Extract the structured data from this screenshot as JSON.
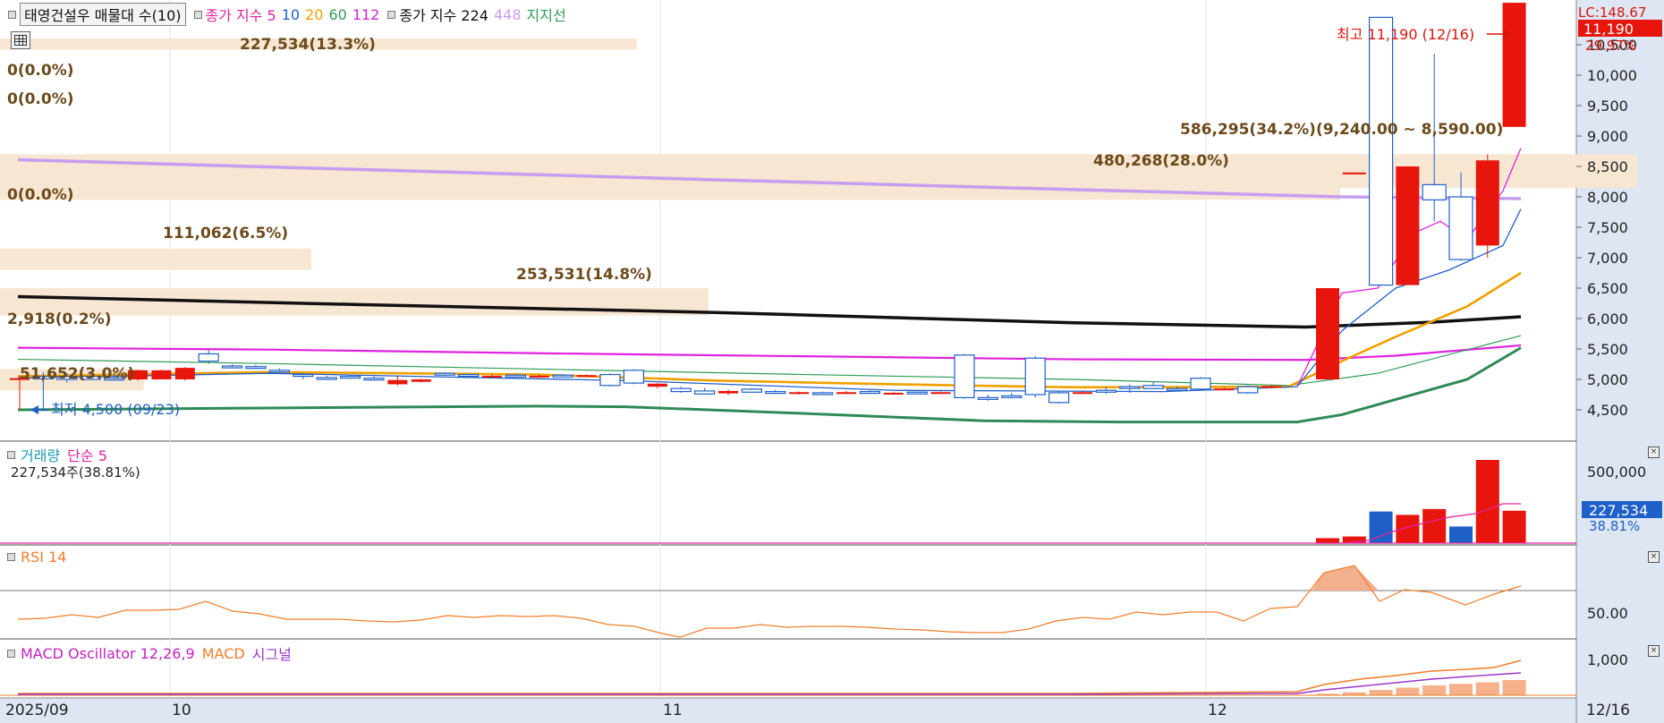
{
  "legend": {
    "stock": "태영건설우 매물대 수(10)",
    "ma_label": "종가 지수 5",
    "ma_periods": [
      "10",
      "20",
      "60",
      "112"
    ],
    "ma2_label": "종가 지수 224",
    "ma2_period": "448",
    "support_label": "지지선"
  },
  "price_axis": {
    "lc_label": "LC:148.67",
    "current_price": "11,190",
    "current_change": "29.97%",
    "ticks": [
      "10,500",
      "10,000",
      "9,500",
      "9,000",
      "8,500",
      "8,000",
      "7,500",
      "7,000",
      "6,500",
      "6,000",
      "5,500",
      "5,000",
      "4,500"
    ]
  },
  "annotations": {
    "high": "최고 11,190 (12/16)",
    "low": "최저 4,500 (09/23)"
  },
  "volume_profile": [
    {
      "label": "227,534(13.3%)"
    },
    {
      "label": "0(0.0%)"
    },
    {
      "label": "0(0.0%)"
    },
    {
      "label": "586,295(34.2%)(9,240.00 ~ 8,590.00)"
    },
    {
      "label": "480,268(28.0%)"
    },
    {
      "label": "0(0.0%)"
    },
    {
      "label": "111,062(6.5%)"
    },
    {
      "label": "253,531(14.8%)"
    },
    {
      "label": "2,918(0.2%)"
    },
    {
      "label": "51,652(3.0%)"
    }
  ],
  "volume_panel": {
    "title": "거래량",
    "ma_label": "단순 5",
    "value": "227,534주(38.81%)",
    "tick": "500,000",
    "current": "227,534",
    "current_pct": "38.81%"
  },
  "rsi_panel": {
    "title": "RSI 14",
    "tick": "50.00"
  },
  "macd_panel": {
    "title": "MACD Oscillator 12,26,9",
    "macd_label": "MACD",
    "signal_label": "시그널",
    "tick": "1,000"
  },
  "x_axis": {
    "labels": [
      "2025/09",
      "10",
      "11",
      "12"
    ],
    "end_label": "12/16"
  },
  "colors": {
    "up": "#e8150c",
    "down": "#1f5fc8",
    "background": "#ffffff",
    "axis_bg": "#dde6f2"
  },
  "chart_data": {
    "type": "candlestick",
    "candles": [
      {
        "date": "09/22",
        "o": 5000,
        "h": 5060,
        "l": 4500,
        "c": 5020
      },
      {
        "date": "09/23",
        "o": 5050,
        "h": 5120,
        "l": 4500,
        "c": 5010
      },
      {
        "date": "09/24",
        "o": 5050,
        "h": 5100,
        "l": 4950,
        "c": 5000
      },
      {
        "date": "09/25",
        "o": 5050,
        "h": 5120,
        "l": 5000,
        "c": 5000
      },
      {
        "date": "09/26",
        "o": 5020,
        "h": 5100,
        "l": 4980,
        "c": 5000
      },
      {
        "date": "09/29",
        "o": 5000,
        "h": 5160,
        "l": 4980,
        "c": 5150
      },
      {
        "date": "09/30",
        "o": 5000,
        "h": 5160,
        "l": 5000,
        "c": 5150
      },
      {
        "date": "10/01",
        "o": 5000,
        "h": 5200,
        "l": 4980,
        "c": 5190
      },
      {
        "date": "10/02",
        "o": 5420,
        "h": 5480,
        "l": 5260,
        "c": 5300
      },
      {
        "date": "10/10",
        "o": 5220,
        "h": 5250,
        "l": 5180,
        "c": 5190
      },
      {
        "date": "10/13",
        "o": 5210,
        "h": 5240,
        "l": 5180,
        "c": 5200
      },
      {
        "date": "10/14",
        "o": 5150,
        "h": 5180,
        "l": 5100,
        "c": 5130
      },
      {
        "date": "10/15",
        "o": 5080,
        "h": 5100,
        "l": 5000,
        "c": 5050
      },
      {
        "date": "10/16",
        "o": 5030,
        "h": 5060,
        "l": 4990,
        "c": 5010
      },
      {
        "date": "10/17",
        "o": 5050,
        "h": 5080,
        "l": 5010,
        "c": 5040
      },
      {
        "date": "10/20",
        "o": 5020,
        "h": 5050,
        "l": 4990,
        "c": 5010
      },
      {
        "date": "10/21",
        "o": 4920,
        "h": 5060,
        "l": 4900,
        "c": 4990
      },
      {
        "date": "10/22",
        "o": 4960,
        "h": 5010,
        "l": 4950,
        "c": 5000
      },
      {
        "date": "10/23",
        "o": 5100,
        "h": 5120,
        "l": 5060,
        "c": 5080
      },
      {
        "date": "10/24",
        "o": 5080,
        "h": 5100,
        "l": 5050,
        "c": 5060
      },
      {
        "date": "10/27",
        "o": 5060,
        "h": 5080,
        "l": 5040,
        "c": 5060
      },
      {
        "date": "10/28",
        "o": 5070,
        "h": 5090,
        "l": 5040,
        "c": 5060
      },
      {
        "date": "10/29",
        "o": 5060,
        "h": 5080,
        "l": 5040,
        "c": 5060
      },
      {
        "date": "10/30",
        "o": 5070,
        "h": 5090,
        "l": 5040,
        "c": 5050
      },
      {
        "date": "10/31",
        "o": 5060,
        "h": 5080,
        "l": 5050,
        "c": 5070
      },
      {
        "date": "11/03",
        "o": 5080,
        "h": 5100,
        "l": 4880,
        "c": 4900
      },
      {
        "date": "11/04",
        "o": 5150,
        "h": 5170,
        "l": 4920,
        "c": 4940
      },
      {
        "date": "11/05",
        "o": 4880,
        "h": 4940,
        "l": 4850,
        "c": 4930
      },
      {
        "date": "11/06",
        "o": 4850,
        "h": 4880,
        "l": 4780,
        "c": 4800
      },
      {
        "date": "11/07",
        "o": 4810,
        "h": 4860,
        "l": 4750,
        "c": 4760
      },
      {
        "date": "11/10",
        "o": 4770,
        "h": 4830,
        "l": 4740,
        "c": 4810
      },
      {
        "date": "11/11",
        "o": 4840,
        "h": 4860,
        "l": 4780,
        "c": 4790
      },
      {
        "date": "11/12",
        "o": 4800,
        "h": 4830,
        "l": 4760,
        "c": 4780
      },
      {
        "date": "11/13",
        "o": 4770,
        "h": 4800,
        "l": 4750,
        "c": 4790
      },
      {
        "date": "11/14",
        "o": 4780,
        "h": 4800,
        "l": 4760,
        "c": 4770
      },
      {
        "date": "11/17",
        "o": 4780,
        "h": 4810,
        "l": 4760,
        "c": 4790
      },
      {
        "date": "11/18",
        "o": 4800,
        "h": 4820,
        "l": 4770,
        "c": 4780
      },
      {
        "date": "11/19",
        "o": 4770,
        "h": 4790,
        "l": 4750,
        "c": 4780
      },
      {
        "date": "11/20",
        "o": 4790,
        "h": 4800,
        "l": 4760,
        "c": 4770
      },
      {
        "date": "11/21",
        "o": 4780,
        "h": 4800,
        "l": 4760,
        "c": 4790
      },
      {
        "date": "11/24",
        "o": 5400,
        "h": 5420,
        "l": 4680,
        "c": 4700
      },
      {
        "date": "11/25",
        "o": 4700,
        "h": 4750,
        "l": 4650,
        "c": 4680
      },
      {
        "date": "11/26",
        "o": 4730,
        "h": 4780,
        "l": 4690,
        "c": 4720
      },
      {
        "date": "11/27",
        "o": 5350,
        "h": 5380,
        "l": 4700,
        "c": 4750
      },
      {
        "date": "11/28",
        "o": 4780,
        "h": 4800,
        "l": 4600,
        "c": 4620
      },
      {
        "date": "12/01",
        "o": 4790,
        "h": 4820,
        "l": 4760,
        "c": 4790
      },
      {
        "date": "12/02",
        "o": 4820,
        "h": 4880,
        "l": 4760,
        "c": 4790
      },
      {
        "date": "12/03",
        "o": 4880,
        "h": 4920,
        "l": 4780,
        "c": 4860
      },
      {
        "date": "12/04",
        "o": 4900,
        "h": 4960,
        "l": 4850,
        "c": 4850
      },
      {
        "date": "12/05",
        "o": 4850,
        "h": 4880,
        "l": 4820,
        "c": 4830
      },
      {
        "date": "12/08",
        "o": 5020,
        "h": 5040,
        "l": 4820,
        "c": 4840
      },
      {
        "date": "12/09",
        "o": 4850,
        "h": 4870,
        "l": 4830,
        "c": 4850
      },
      {
        "date": "12/10",
        "o": 4880,
        "h": 4900,
        "l": 4760,
        "c": 4780
      },
      {
        "date": "12/11",
        "o": 4890,
        "h": 4910,
        "l": 4860,
        "c": 4890
      },
      {
        "date": "12/12",
        "o": 5000,
        "h": 6500,
        "l": 5000,
        "c": 6500
      },
      {
        "date": "12/12b",
        "o": 8400,
        "h": 8400,
        "l": 8400,
        "c": 8400
      },
      {
        "date": "12/15a",
        "o": 10950,
        "h": 10950,
        "l": 6550,
        "c": 6550
      },
      {
        "date": "12/15b",
        "o": 6550,
        "h": 8500,
        "l": 6550,
        "c": 8500
      },
      {
        "date": "12/15c",
        "o": 8200,
        "h": 10350,
        "l": 7600,
        "c": 7950
      },
      {
        "date": "12/15d",
        "o": 8000,
        "h": 8400,
        "l": 6950,
        "c": 6970
      },
      {
        "date": "12/15e",
        "o": 7200,
        "h": 8700,
        "l": 7000,
        "c": 8600
      },
      {
        "date": "12/16",
        "o": 9150,
        "h": 11190,
        "l": 9150,
        "c": 11190
      }
    ],
    "ylim": [
      4250,
      11300
    ]
  }
}
